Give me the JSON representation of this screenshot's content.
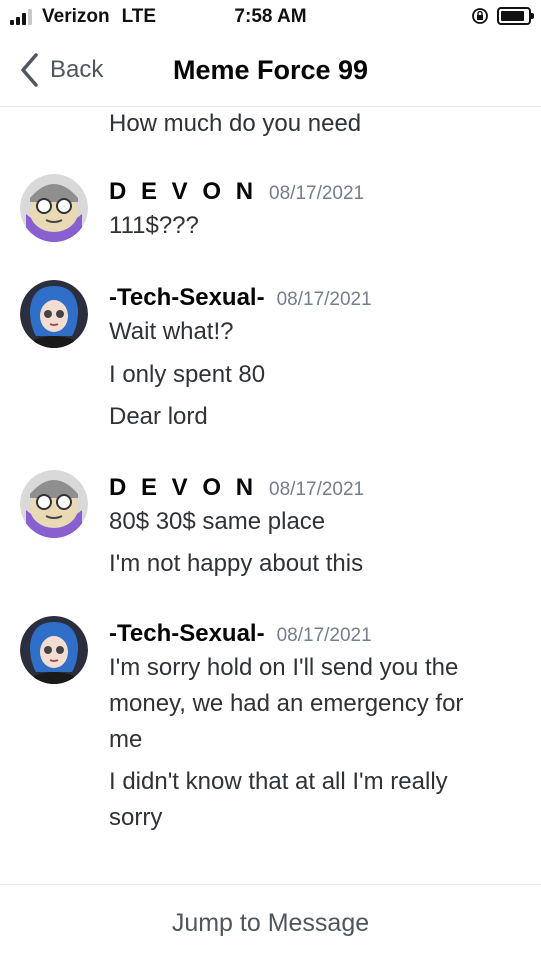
{
  "status_bar": {
    "carrier": "Verizon",
    "network": "LTE",
    "time": "7:58 AM",
    "icons": [
      "signal-icon",
      "rotation-lock-icon",
      "battery-icon"
    ]
  },
  "nav": {
    "back_label": "Back",
    "title": "Meme Force 99",
    "back_icon": "chevron-left-icon"
  },
  "top_message": "How much do you need",
  "groups": [
    {
      "author": "D E V O N",
      "timestamp": "08/17/2021",
      "lines": [
        "111$???"
      ]
    },
    {
      "author": "-Tech-Sexual-",
      "timestamp": "08/17/2021",
      "lines": [
        "Wait what!?",
        "I only spent 80",
        "Dear lord"
      ]
    },
    {
      "author": "D E V O N",
      "timestamp": "08/17/2021",
      "lines": [
        "80$ 30$ same place",
        "I'm not happy about this"
      ]
    },
    {
      "author": "-Tech-Sexual-",
      "timestamp": "08/17/2021",
      "lines": [
        "I'm sorry hold on I'll send you the money, we had an emergency for me",
        "I didn't know that at all I'm really sorry"
      ]
    }
  ],
  "footer": {
    "jump_label": "Jump to Message"
  },
  "colors": {
    "text": "#2e3338",
    "muted": "#747f8d",
    "author": "#060607",
    "divider": "#e4e6e8"
  }
}
